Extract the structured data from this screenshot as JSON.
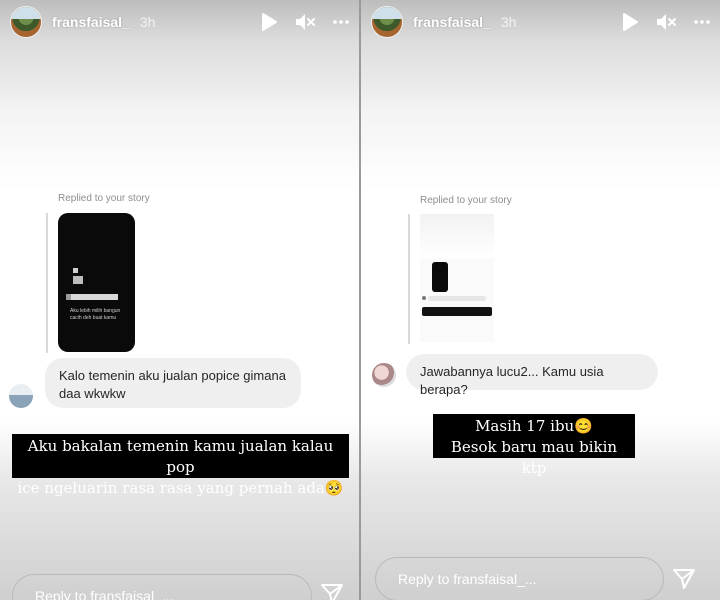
{
  "stories": [
    {
      "header": {
        "username": "fransfaisal_",
        "time": "3h"
      },
      "replied_label": "Replied to your story",
      "quoted_story_text": "Aku lebih milih bangun cacih deh buat kamu",
      "message": "Kalo temenin aku jualan popice gimana daa wkwkw",
      "caption_lines": [
        "Aku bakalan temenin kamu jualan kalau pop",
        "ice ngeluarin rasa rasa yang pernah ada🥺"
      ],
      "reply_placeholder": "Reply to fransfaisal_..."
    },
    {
      "header": {
        "username": "fransfaisal_",
        "time": "3h"
      },
      "replied_label": "Replied to your story",
      "message": "Jawabannya lucu2... Kamu usia berapa?",
      "caption_lines": [
        "Masih 17 ibu😊",
        "Besok baru mau bikin ktp"
      ],
      "reply_placeholder": "Reply to fransfaisal_..."
    }
  ],
  "icons": {
    "play": "play-icon",
    "mute": "mute-icon",
    "more": "more-icon",
    "send": "send-icon"
  }
}
